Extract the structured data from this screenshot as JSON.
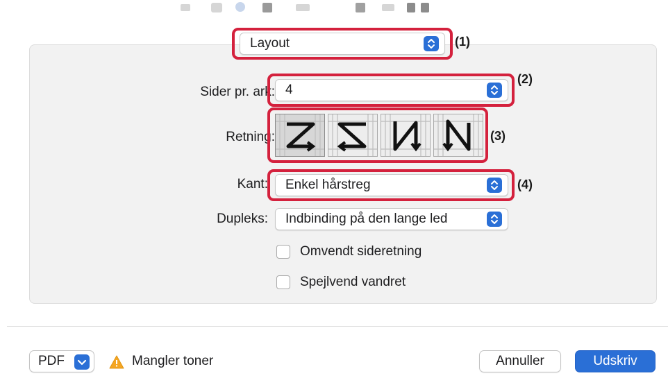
{
  "colors": {
    "accent": "#2a6fd6",
    "highlight": "#d4213d",
    "warning": "#f5a623"
  },
  "section_popup": {
    "value": "Layout",
    "callout": "(1)"
  },
  "pages_per_sheet": {
    "label": "Sider pr. ark:",
    "value": "4",
    "callout": "(2)"
  },
  "direction": {
    "label": "Retning:",
    "callout": "(3)",
    "options": [
      {
        "glyph": "Z",
        "icon": "z-order-icon",
        "selected": true
      },
      {
        "glyph": "reverse-Z",
        "icon": "reverse-z-order-icon",
        "selected": false
      },
      {
        "glyph": "И",
        "icon": "reverse-n-order-icon",
        "selected": false
      },
      {
        "glyph": "N",
        "icon": "n-order-icon",
        "selected": false
      }
    ]
  },
  "border": {
    "label": "Kant:",
    "value": "Enkel hårstreg",
    "callout": "(4)"
  },
  "duplex": {
    "label": "Dupleks:",
    "value": "Indbinding på den lange led"
  },
  "checkboxes": [
    {
      "label": "Omvendt sideretning",
      "checked": false
    },
    {
      "label": "Spejlvend vandret",
      "checked": false
    }
  ],
  "footer": {
    "pdf_label": "PDF",
    "warning_text": "Mangler toner",
    "cancel_label": "Annuller",
    "print_label": "Udskriv"
  }
}
